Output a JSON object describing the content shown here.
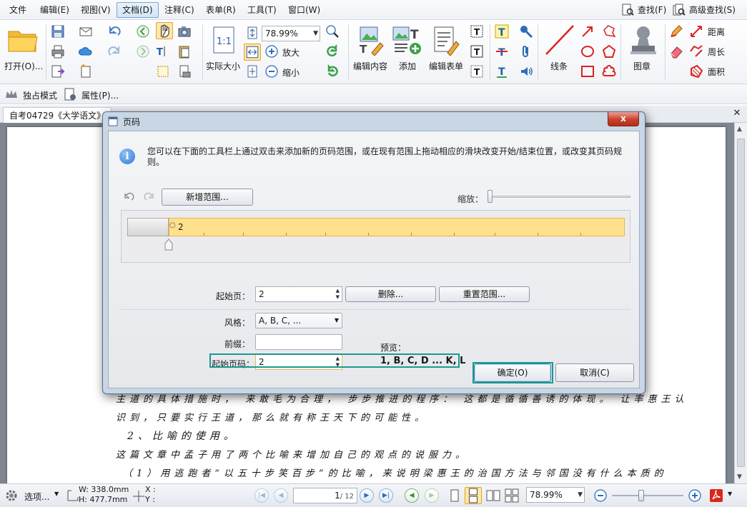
{
  "menu": {
    "items": [
      "文件",
      "编辑(E)",
      "视图(V)",
      "文档(D)",
      "注释(C)",
      "表单(R)",
      "工具(T)",
      "窗口(W)"
    ],
    "active_index": 3,
    "find": "查找(F)",
    "advanced_find": "高级查找(S)"
  },
  "toolbar": {
    "open": "打开(O)...",
    "actual_size": "实际大小",
    "zoom_value": "78.99%",
    "zoom_in": "放大",
    "zoom_out": "缩小",
    "edit_content": "编辑内容",
    "add": "添加",
    "edit_form": "编辑表单",
    "line": "线条",
    "stamp": "图章",
    "distance": "距离",
    "perimeter": "周长",
    "area": "面积"
  },
  "toolbar2": {
    "exclusive_mode": "独占模式",
    "properties": "属性(P)..."
  },
  "doc": {
    "tab_title": "自考04729《大学语文》",
    "lines": [
      "主道的具体措施时，  来敢毛为合理，  步步推进的程序：  这都是循循善诱的体现。  让率惠王认",
      "识到，只要实行王道，那么就有称王天下的可能性。",
      "2、比喻的使用。",
      "这篇文章中孟子用了两个比喻来增加自己的观点的说服力。",
      "（1）用逃跑者“以五十步笑百步”的比喻，来说明梁惠王的治国方法与邻国没有什么本质的"
    ]
  },
  "dialog": {
    "title": "页码",
    "close": "x",
    "info": "您可以在下面的工具栏上通过双击来添加新的页码范围，或在现有范围上拖动相应的滑块改变开始/结束位置，或改变其页码规则。",
    "add_range": "新增范围...",
    "zoom_label": "缩放：",
    "range_label": "2",
    "start_page_label": "起始页：",
    "start_page_value": "2",
    "delete": "删除...",
    "reset_range": "重置范围...",
    "style_label": "风格：",
    "style_value": "A, B, C, ...",
    "prefix_label": "前缀：",
    "prefix_value": "",
    "preview_label": "预览：",
    "start_number_label": "起始页码：",
    "start_number_value": "2",
    "preview_value": "1, B, C, D ... K, L",
    "ok": "确定(O)",
    "cancel": "取消(C)"
  },
  "status": {
    "options": "选项...",
    "width": "W: 338.0mm",
    "height": "H: 477.7mm",
    "x": "X :",
    "y": "Y :",
    "page_current": "1",
    "page_total": "/ 12",
    "zoom_value": "78.99%"
  },
  "colors": {
    "accent": "#2f7bd0",
    "range_bar": "#ffe08d",
    "highlight": "#1a9a8e",
    "close_red": "#c7412d"
  }
}
